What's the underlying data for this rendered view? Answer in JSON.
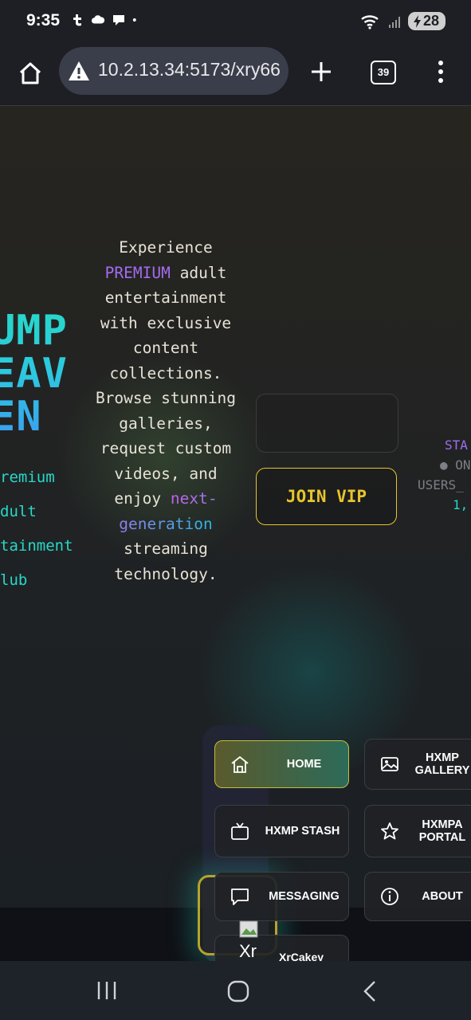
{
  "status_bar": {
    "time": "9:35",
    "battery": "28"
  },
  "browser": {
    "url": "10.2.13.34:5173/xry66",
    "tab_count": "39"
  },
  "hero": {
    "brand_lines": [
      "UMP",
      "EAV",
      "EN"
    ],
    "tagline_lines": [
      "remium",
      "dult",
      "tainment",
      "lub"
    ],
    "desc": {
      "pre": "Experience",
      "highlight1": "PREMIUM",
      "mid": "adult entertainment with exclusive content collections. Browse stunning galleries, request custom videos, and enjoy",
      "highlight2": "next-generation",
      "post": "streaming technology."
    },
    "join_button": "JOIN VIP",
    "stats": [
      "STA",
      "● ON",
      "USERS_",
      "1,"
    ]
  },
  "nav": {
    "items": [
      {
        "label": "HOME",
        "icon": "home-icon"
      },
      {
        "label": "HXMP GALLERY",
        "icon": "image-icon"
      },
      {
        "label": "HXMP STASH",
        "icon": "tv-icon"
      },
      {
        "label": "HXMPA PORTAL",
        "icon": "star-icon"
      },
      {
        "label": "MESSAGING",
        "icon": "chat-icon"
      },
      {
        "label": "ABOUT",
        "icon": "info-icon"
      }
    ],
    "broken_image_alt": "Xr",
    "partial_label": "XrCakey"
  },
  "colors": {
    "accent_cyan": "#27d8c9",
    "accent_purple": "#a46bf0",
    "accent_gold": "#e6c52c"
  }
}
